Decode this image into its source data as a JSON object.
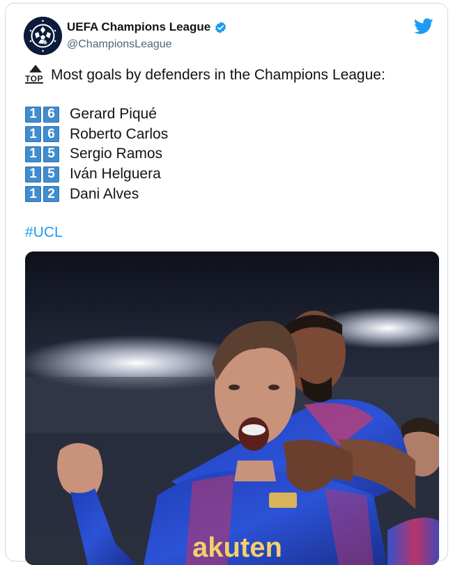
{
  "tweet": {
    "account_name": "UEFA Champions League",
    "handle": "@ChampionsLeague",
    "top_emoji_text": "TOP",
    "headline": "Most goals by defenders in the Champions League:",
    "players": [
      {
        "d1": "1",
        "d2": "6",
        "name": "Gerard Piqué"
      },
      {
        "d1": "1",
        "d2": "6",
        "name": "Roberto Carlos"
      },
      {
        "d1": "1",
        "d2": "5",
        "name": "Sergio Ramos"
      },
      {
        "d1": "1",
        "d2": "5",
        "name": "Iván Helguera"
      },
      {
        "d1": "1",
        "d2": "2",
        "name": "Dani Alves"
      }
    ],
    "hashtag": "#UCL",
    "shirt_sponsor": "akuten"
  },
  "colors": {
    "twitter_blue": "#1d9bf0",
    "keycap_blue": "#3f8ccf",
    "handle_gray": "#536471"
  },
  "icons": [
    "champions-league-logo",
    "verified-badge-icon",
    "twitter-bird-icon",
    "top-arrow-icon"
  ]
}
